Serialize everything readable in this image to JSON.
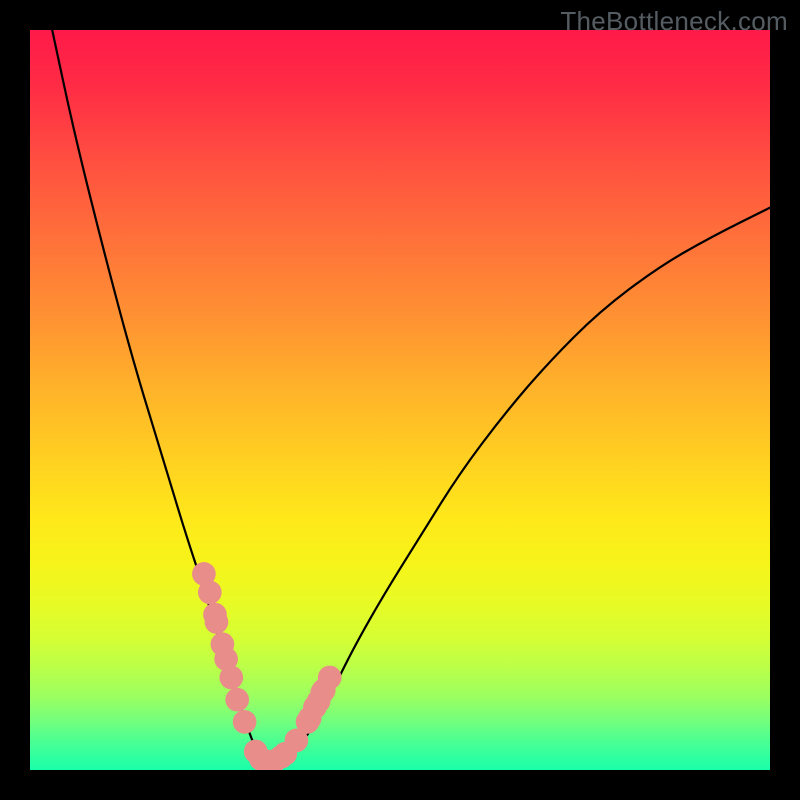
{
  "attribution": "TheBottleneck.com",
  "chart_data": {
    "type": "line",
    "title": "",
    "xlabel": "",
    "ylabel": "",
    "xlim": [
      0,
      100
    ],
    "ylim": [
      0,
      100
    ],
    "grid": false,
    "legend": false,
    "series": [
      {
        "name": "bottleneck-curve",
        "color": "#000000",
        "x": [
          3,
          6,
          10,
          14,
          18,
          21,
          24,
          26,
          27.5,
          29,
          30,
          31,
          32,
          33.5,
          35,
          37,
          39,
          41,
          44,
          48,
          53,
          58,
          64,
          70,
          77,
          85,
          92,
          100
        ],
        "y": [
          100,
          86,
          70,
          55,
          42,
          32,
          23,
          16,
          11,
          7,
          4,
          2,
          1,
          1,
          2,
          4,
          7,
          11,
          17,
          24,
          32,
          40,
          48,
          55,
          62,
          68,
          72,
          76
        ]
      }
    ],
    "markers": {
      "name": "data-points",
      "color": "#e98d8a",
      "radius_axis_units": 1.6,
      "x": [
        23.5,
        24.3,
        25.0,
        25.2,
        26.0,
        26.5,
        27.2,
        28.0,
        29.0,
        30.5,
        31.2,
        31.5,
        33.0,
        34.0,
        34.5,
        36.0,
        37.5,
        37.8,
        38.5,
        39.0,
        39.5,
        39.7,
        40.5
      ],
      "y": [
        26.5,
        24.0,
        21.0,
        20.0,
        17.0,
        15.0,
        12.5,
        9.5,
        6.5,
        2.5,
        1.5,
        1.3,
        1.2,
        1.8,
        2.2,
        4.0,
        6.5,
        7.0,
        8.5,
        9.3,
        10.5,
        10.8,
        12.5
      ]
    }
  }
}
